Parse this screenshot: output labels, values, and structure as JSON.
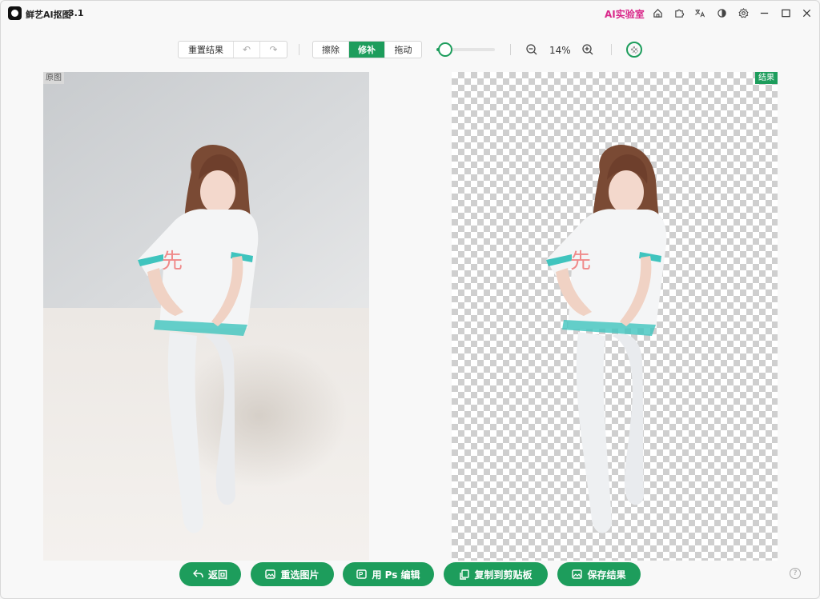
{
  "app": {
    "name": "鲜艺AI抠图",
    "version": "3.1",
    "lab_link": "AI实验室"
  },
  "titlebar_icons": [
    "home-icon",
    "puzzle-icon",
    "translate-icon",
    "contrast-icon",
    "settings-icon",
    "minimize-icon",
    "maximize-icon",
    "close-icon"
  ],
  "toolbar": {
    "reset_label": "重置结果",
    "undo_glyph": "↶",
    "redo_glyph": "↷",
    "modes": [
      {
        "label": "擦除",
        "active": false
      },
      {
        "label": "修补",
        "active": true
      },
      {
        "label": "拖动",
        "active": false
      }
    ],
    "brush_level": 0.15,
    "zoom_label": "14%"
  },
  "panels": {
    "original_tag": "原图",
    "result_tag": "结果"
  },
  "actions": [
    {
      "label": "返回",
      "icon": "back-icon"
    },
    {
      "label": "重选图片",
      "icon": "image-icon"
    },
    {
      "label": "用 Ps 编辑",
      "icon": "ps-icon"
    },
    {
      "label": "复制到剪贴板",
      "icon": "copy-icon"
    },
    {
      "label": "保存结果",
      "icon": "save-image-icon"
    }
  ],
  "colors": {
    "accent": "#1d9d5c",
    "lab": "#d9288a"
  },
  "help_glyph": "?"
}
